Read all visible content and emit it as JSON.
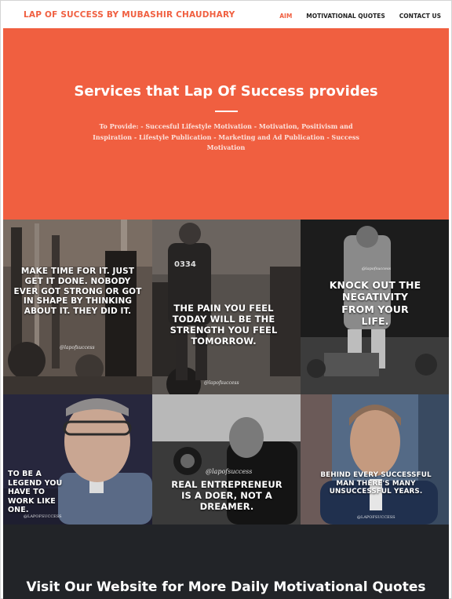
{
  "nav": {
    "brand": "LAP OF SUCCESS BY MUBASHIR CHAUDHARY",
    "links": [
      "AIM",
      "MOTIVATIONAL QUOTES",
      "CONTACT US"
    ],
    "active_index": 0
  },
  "hero": {
    "title": "Services that Lap Of Success provides",
    "text": "To Provide: - Succesful Lifestyle Motivation - Motivation, Positivism and Inspiration - Lifestyle Publication - Marketing and Ad Publication - Success Motivation"
  },
  "gallery": [
    {
      "caption": "MAKE TIME FOR IT. JUST GET IT DONE. NOBODY EVER GOT STRONG OR GOT IN SHAPE BY THINKING ABOUT IT. THEY DID IT.",
      "watermark": "@lapofsuccess"
    },
    {
      "caption": "THE PAIN YOU FEEL TODAY WILL BE THE STRENGTH YOU FEEL TOMORROW.",
      "watermark": "@lapofsuccess"
    },
    {
      "caption": "KNOCK OUT THE NEGATIVITY FROM YOUR LIFE.",
      "watermark": "@lapofsuccess"
    },
    {
      "caption": "TO BE A LEGEND YOU HAVE TO WORK LIKE ONE.",
      "watermark": "@LAPOFSUCCESS"
    },
    {
      "caption": "REAL ENTREPRENEUR IS A DOER, NOT A DREAMER.",
      "watermark": "@lapofsuccess"
    },
    {
      "caption": "BEHIND EVERY SUCCESSFUL MAN THERE'S MANY UNSUCCESSFUL YEARS.",
      "watermark": "@LAPOFSUCCESS"
    }
  ],
  "footer": {
    "title": "Visit Our Website for More Daily Motivational Quotes"
  },
  "colors": {
    "accent": "#f05f40",
    "footer_bg": "#222428"
  }
}
